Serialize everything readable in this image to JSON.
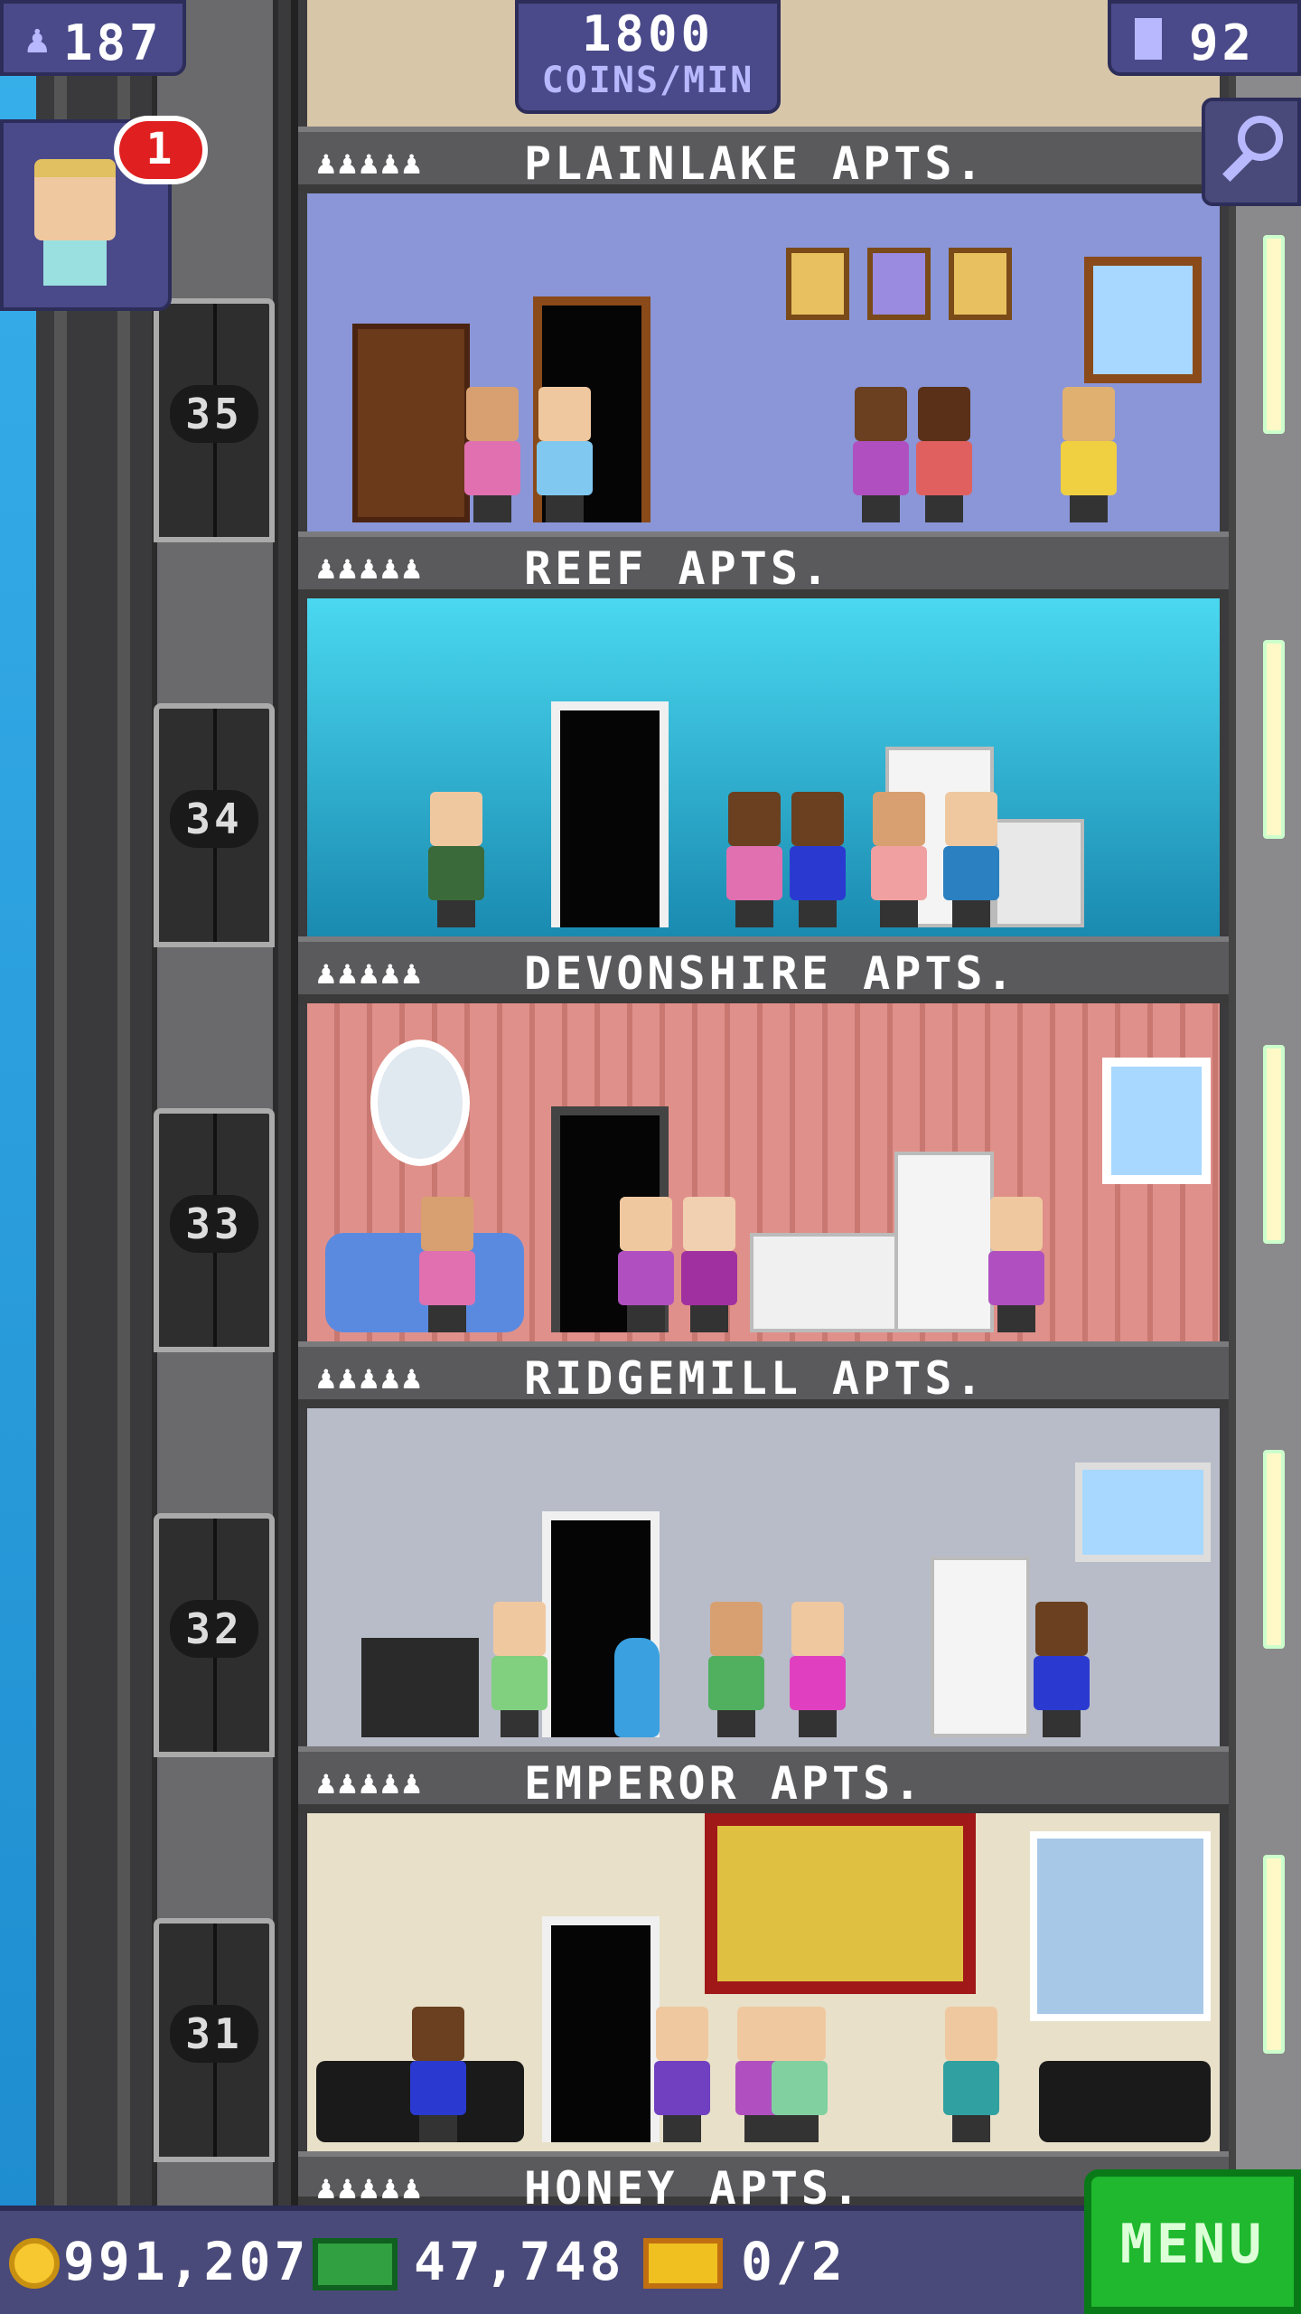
{
  "hud": {
    "population": "187",
    "coins_rate_value": "1800",
    "coins_rate_unit": "COINS/MIN",
    "floors": "92",
    "visitor_notification_count": "1"
  },
  "floors": [
    {
      "name": "PLAINLAKE APTS.",
      "people_icons": "♟♟♟♟♟",
      "elevator_floor": "35"
    },
    {
      "name": "REEF APTS.",
      "people_icons": "♟♟♟♟♟",
      "elevator_floor": "34"
    },
    {
      "name": "DEVONSHIRE APTS.",
      "people_icons": "♟♟♟♟♟",
      "elevator_floor": "33"
    },
    {
      "name": "RIDGEMILL APTS.",
      "people_icons": "♟♟♟♟♟",
      "elevator_floor": "32"
    },
    {
      "name": "EMPEROR APTS.",
      "people_icons": "♟♟♟♟♟",
      "elevator_floor": "31"
    },
    {
      "name": "HONEY APTS.",
      "people_icons": "♟♟♟♟♟"
    }
  ],
  "bottom": {
    "coins": "991,207",
    "bux": "47,748",
    "tickets": "0/2",
    "menu_label": "MENU"
  },
  "icons": {
    "population": "person-icon",
    "floors": "building-icon",
    "coins": "coin-icon",
    "bux": "bux-icon",
    "tickets": "ticket-icon",
    "zoom": "magnifier-icon"
  },
  "colors": {
    "hud": "#4a4a7a",
    "menu": "#1fb82e",
    "badge": "#e02020"
  }
}
